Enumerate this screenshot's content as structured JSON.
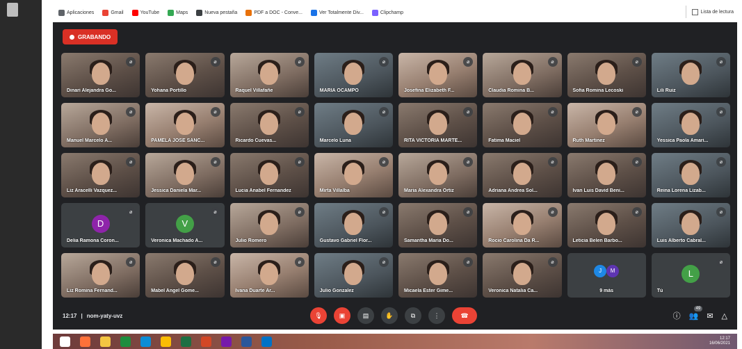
{
  "bookmarks": [
    {
      "label": "Aplicaciones",
      "color": "#5f6368"
    },
    {
      "label": "Gmail",
      "color": "#ea4335"
    },
    {
      "label": "YouTube",
      "color": "#ff0000"
    },
    {
      "label": "Maps",
      "color": "#34a853"
    },
    {
      "label": "Nueva pestaña",
      "color": "#3c4043"
    },
    {
      "label": "PDF a DOC - Conve...",
      "color": "#e8710a"
    },
    {
      "label": "Ver Totalmente Div...",
      "color": "#1a73e8"
    },
    {
      "label": "Clipchamp",
      "color": "#7b61ff"
    }
  ],
  "reading_list": "Lista de lectura",
  "recording_label": "GRABANDO",
  "participants": [
    {
      "name": "Dinari Alejandra Go..."
    },
    {
      "name": "Yohana Portillo"
    },
    {
      "name": "Raquel Villafañe"
    },
    {
      "name": "MARIA OCAMPO"
    },
    {
      "name": "Josefina Elizabeth F..."
    },
    {
      "name": "Claudia Romina B..."
    },
    {
      "name": "Sofia Romina Lecoski"
    },
    {
      "name": "Lili Ruiz"
    },
    {
      "name": "Manuel Marcelo A..."
    },
    {
      "name": "PAMELA JOSE SANC..."
    },
    {
      "name": "Ricardo Cuevas..."
    },
    {
      "name": "Marcelo Luna"
    },
    {
      "name": "RITA VICTORIA MARTE..."
    },
    {
      "name": "Fatima Maciel"
    },
    {
      "name": "Ruth Martinez"
    },
    {
      "name": "Yessica Paola Amari..."
    },
    {
      "name": "Liz Aracelli Vazquez..."
    },
    {
      "name": "Jessica Daniela Mar..."
    },
    {
      "name": "Lucia Anabel Fernandez"
    },
    {
      "name": "Mirta Villalba"
    },
    {
      "name": "Maria Alexandra Ortiz"
    },
    {
      "name": "Adriana Andrea Sol..."
    },
    {
      "name": "Ivan Luis David Beni..."
    },
    {
      "name": "Reina Lorena Lizab..."
    },
    {
      "name": "Delia Ramona Coron...",
      "initial": "D",
      "avatar_color": "#8e24aa"
    },
    {
      "name": "Veronica Machado A...",
      "initial": "V",
      "avatar_color": "#43a047"
    },
    {
      "name": "Julio Romero"
    },
    {
      "name": "Gustavo Gabriel Flor..."
    },
    {
      "name": "Samantha Maria Do..."
    },
    {
      "name": "Rocio Carolina Da R..."
    },
    {
      "name": "Leticia Belen Barbo..."
    },
    {
      "name": "Luis Alberto Cabral..."
    },
    {
      "name": "Liz Romina Fernand..."
    },
    {
      "name": "Mabel Angel Gome..."
    },
    {
      "name": "Ivana Duarte Ar..."
    },
    {
      "name": "Julio Gonzalez"
    },
    {
      "name": "Micaela Ester Gime..."
    },
    {
      "name": "Veronica Natalia Ca..."
    },
    {
      "name": "9 más",
      "more": true,
      "avatars": [
        {
          "initial": "J",
          "color": "#1e88e5"
        },
        {
          "initial": "M",
          "color": "#5e35b1"
        }
      ]
    },
    {
      "name": "Tú",
      "initial": "L",
      "avatar_color": "#43a047"
    }
  ],
  "meeting": {
    "time": "12:17",
    "separator": "|",
    "code": "nom-yaty-uvz"
  },
  "controls": [
    "mic-off",
    "camera-off",
    "captions",
    "raise-hand",
    "present",
    "more",
    "leave"
  ],
  "right_controls": {
    "people_count": "49"
  },
  "tray": {
    "time": "12:17",
    "date": "16/06/2021"
  },
  "taskbar_apps": [
    {
      "name": "windows",
      "color": "#ffffff"
    },
    {
      "name": "firefox",
      "color": "#ff7139"
    },
    {
      "name": "file-explorer",
      "color": "#f4c542"
    },
    {
      "name": "app-green",
      "color": "#1e8e3e"
    },
    {
      "name": "edge",
      "color": "#0c8dd6"
    },
    {
      "name": "chrome",
      "color": "#fbbc04"
    },
    {
      "name": "excel",
      "color": "#1d6f42"
    },
    {
      "name": "powerpoint",
      "color": "#d24726"
    },
    {
      "name": "onenote",
      "color": "#7719aa"
    },
    {
      "name": "word",
      "color": "#2b579a"
    },
    {
      "name": "outlook",
      "color": "#0072c6"
    }
  ]
}
